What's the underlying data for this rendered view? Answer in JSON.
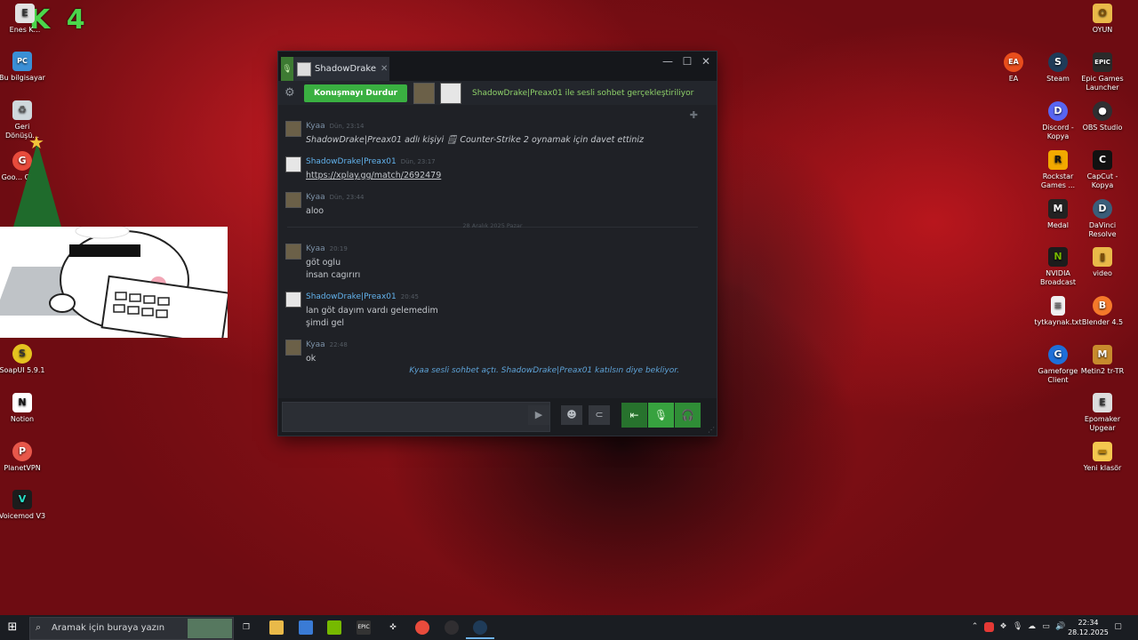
{
  "desktop": {
    "badge_text": "K 4",
    "left_icons": [
      {
        "label": "Enes K...",
        "color": "#e2e2e2",
        "glyph": "E"
      },
      {
        "label": "Bu bilgisayar",
        "color": "#3a8fd6",
        "glyph": "PC"
      },
      {
        "label": "Geri Dönüşü...",
        "color": "#cfd8dc",
        "glyph": "♻"
      },
      {
        "label": "Goo... Chr...",
        "color": "#e84b3c",
        "glyph": "G"
      },
      {
        "label": "SoapUI 5.9.1",
        "color": "#e4c320",
        "glyph": "S"
      },
      {
        "label": "Notion",
        "color": "#ffffff",
        "glyph": "N"
      },
      {
        "label": "PlanetVPN",
        "color": "#e8574a",
        "glyph": "P"
      },
      {
        "label": "Voicemod V3",
        "color": "#1c1c1c",
        "glyph": "V"
      }
    ],
    "right_col1": [
      {
        "label": "EA",
        "color": "#e84d1c",
        "glyph": "EA"
      },
      {
        "label": "Steam",
        "color": "#1f3b58",
        "glyph": "S"
      },
      {
        "label": "Discord - Kopya",
        "color": "#5865f2",
        "glyph": "D"
      },
      {
        "label": "Rockstar Games ...",
        "color": "#f2a900",
        "glyph": "R"
      },
      {
        "label": "Medal",
        "color": "#222222",
        "glyph": "M"
      },
      {
        "label": "NVIDIA Broadcast",
        "color": "#76b900",
        "glyph": "N"
      },
      {
        "label": "tytkaynak.txt",
        "color": "#f0f0f0",
        "glyph": "≡"
      },
      {
        "label": "Gameforge Client",
        "color": "#1e6fd9",
        "glyph": "G"
      }
    ],
    "right_col2": [
      {
        "label": "OYUN",
        "color": "#e9b949",
        "glyph": "O"
      },
      {
        "label": "Epic Games Launcher",
        "color": "#2a2a2a",
        "glyph": "EPIC"
      },
      {
        "label": "OBS Studio",
        "color": "#302e31",
        "glyph": "●"
      },
      {
        "label": "CapCut - Kopya",
        "color": "#111111",
        "glyph": "C"
      },
      {
        "label": "DaVinci Resolve",
        "color": "#3a5e7a",
        "glyph": "D"
      },
      {
        "label": "video",
        "color": "#e9b949",
        "glyph": "▮"
      },
      {
        "label": "Blender 4.5",
        "color": "#f5792a",
        "glyph": "B"
      },
      {
        "label": "Metin2 tr-TR",
        "color": "#c88b2d",
        "glyph": "M"
      },
      {
        "label": "Epomaker Upgear",
        "color": "#dddddd",
        "glyph": "E"
      },
      {
        "label": "Yeni klasör",
        "color": "#f4c74f",
        "glyph": "▬"
      }
    ]
  },
  "chat": {
    "tab_name": "ShadowDrake|Pr",
    "window_controls": {
      "minimize": "—",
      "maximize": "☐",
      "close": "✕"
    },
    "callbar": {
      "stop_label": "Konuşmayı Durdur",
      "status": "ShadowDrake|Preax01 ile sesli sohbet gerçekleştiriliyor"
    },
    "messages": [
      {
        "user": "Kyaa",
        "time": "Dün, 23:14",
        "lines": [
          "ShadowDrake|Preax01 adlı kişiyi 🗒 Counter-Strike 2 oynamak için davet ettiniz"
        ]
      },
      {
        "user": "ShadowDrake|Preax01",
        "time": "Dün, 23:17",
        "lines": [
          "https://xplay.gg/match/2692479"
        ]
      },
      {
        "user": "Kyaa",
        "time": "Dün, 23:44",
        "lines": [
          "aloo"
        ]
      },
      {
        "user": "Kyaa",
        "time": "20:19",
        "lines": [
          "göt oglu",
          "insan cagırırı"
        ]
      },
      {
        "user": "ShadowDrake|Preax01",
        "time": "20:45",
        "lines": [
          "lan göt dayım vardı gelemedim",
          "şimdi gel"
        ]
      },
      {
        "user": "Kyaa",
        "time": "22:48",
        "lines": [
          "ok"
        ]
      }
    ],
    "date_divider": "28 Aralık 2025 Pazar",
    "voice_note": "Kyaa sesli sohbet açtı. ShadowDrake|Preax01 katılsın diye bekliyor.",
    "input_placeholder": ""
  },
  "taskbar": {
    "search_placeholder": "Aramak için buraya yazın",
    "clock_time": "22:34",
    "clock_date": "28.12.2025"
  },
  "colors": {
    "accent_green": "#3ab041",
    "link_blue": "#6fb4ef",
    "kyaa_name": "#7d92a8",
    "shadow_name": "#62b2ec"
  }
}
